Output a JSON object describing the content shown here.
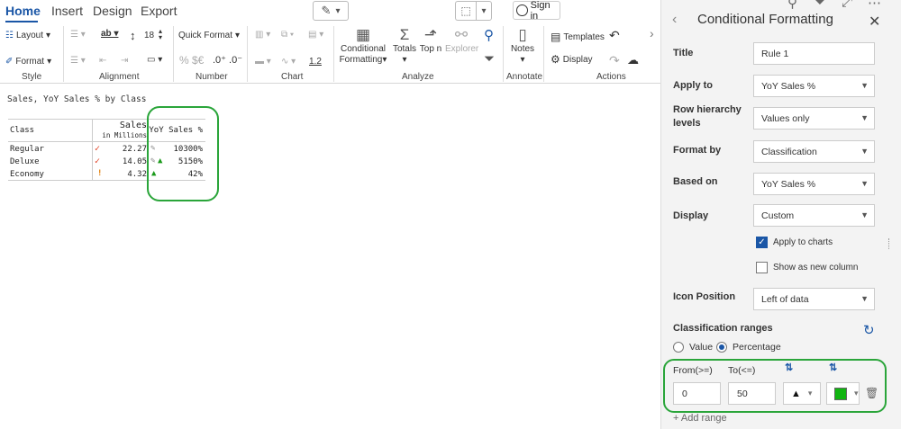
{
  "menu": {
    "tabs": [
      "Home",
      "Insert",
      "Design",
      "Export"
    ],
    "signin": "Sign in"
  },
  "ribbon": {
    "groups": {
      "style": "Style",
      "alignment": "Alignment",
      "number": "Number",
      "chart": "Chart",
      "analyze": "Analyze",
      "annotate": "Annotate",
      "actions": "Actions"
    },
    "layout": "Layout",
    "format": "Format",
    "font_size": "18",
    "quick_format": "Quick Format",
    "currency": "% $€",
    "decimals": ".0⁺ .0⁻",
    "number_fmt": "1.2",
    "conditional": "Conditional",
    "formatting": "Formatting",
    "totals": "Totals",
    "topn": "Top n",
    "explorer": "Explorer",
    "notes": "Notes",
    "templates": "Templates",
    "display": "Display"
  },
  "report": {
    "title": "Sales, YoY Sales % by Class",
    "headers": {
      "class": "Class",
      "sales": "Sales",
      "sales_sub": "in Millions",
      "yoy": "YoY Sales %"
    },
    "rows": [
      {
        "class": "Regular",
        "sales": "22.27",
        "yoy": "10300%"
      },
      {
        "class": "Deluxe",
        "sales": "14.05",
        "yoy": "5150%"
      },
      {
        "class": "Economy",
        "sales": "4.32",
        "yoy": "42%"
      }
    ]
  },
  "panel": {
    "title": "Conditional Formatting",
    "fields": {
      "title_label": "Title",
      "title_value": "Rule 1",
      "apply_label": "Apply to",
      "apply_value": "YoY Sales %",
      "row_label": "Row hierarchy levels",
      "row_value": "Values only",
      "format_label": "Format by",
      "format_value": "Classification",
      "based_label": "Based on",
      "based_value": "YoY Sales %",
      "display_label": "Display",
      "display_value": "Custom",
      "icon_pos_label": "Icon Position",
      "icon_pos_value": "Left of data"
    },
    "apply_to_charts": "Apply to charts",
    "show_new_column": "Show as new column",
    "class_ranges": "Classification ranges",
    "radio_value": "Value",
    "radio_percentage": "Percentage",
    "from_label": "From(>=)",
    "to_label": "To(<=)",
    "from_value": "0",
    "to_value": "50",
    "icon_shape": "▲",
    "color": "#11b511",
    "add_range": "+ Add range"
  }
}
